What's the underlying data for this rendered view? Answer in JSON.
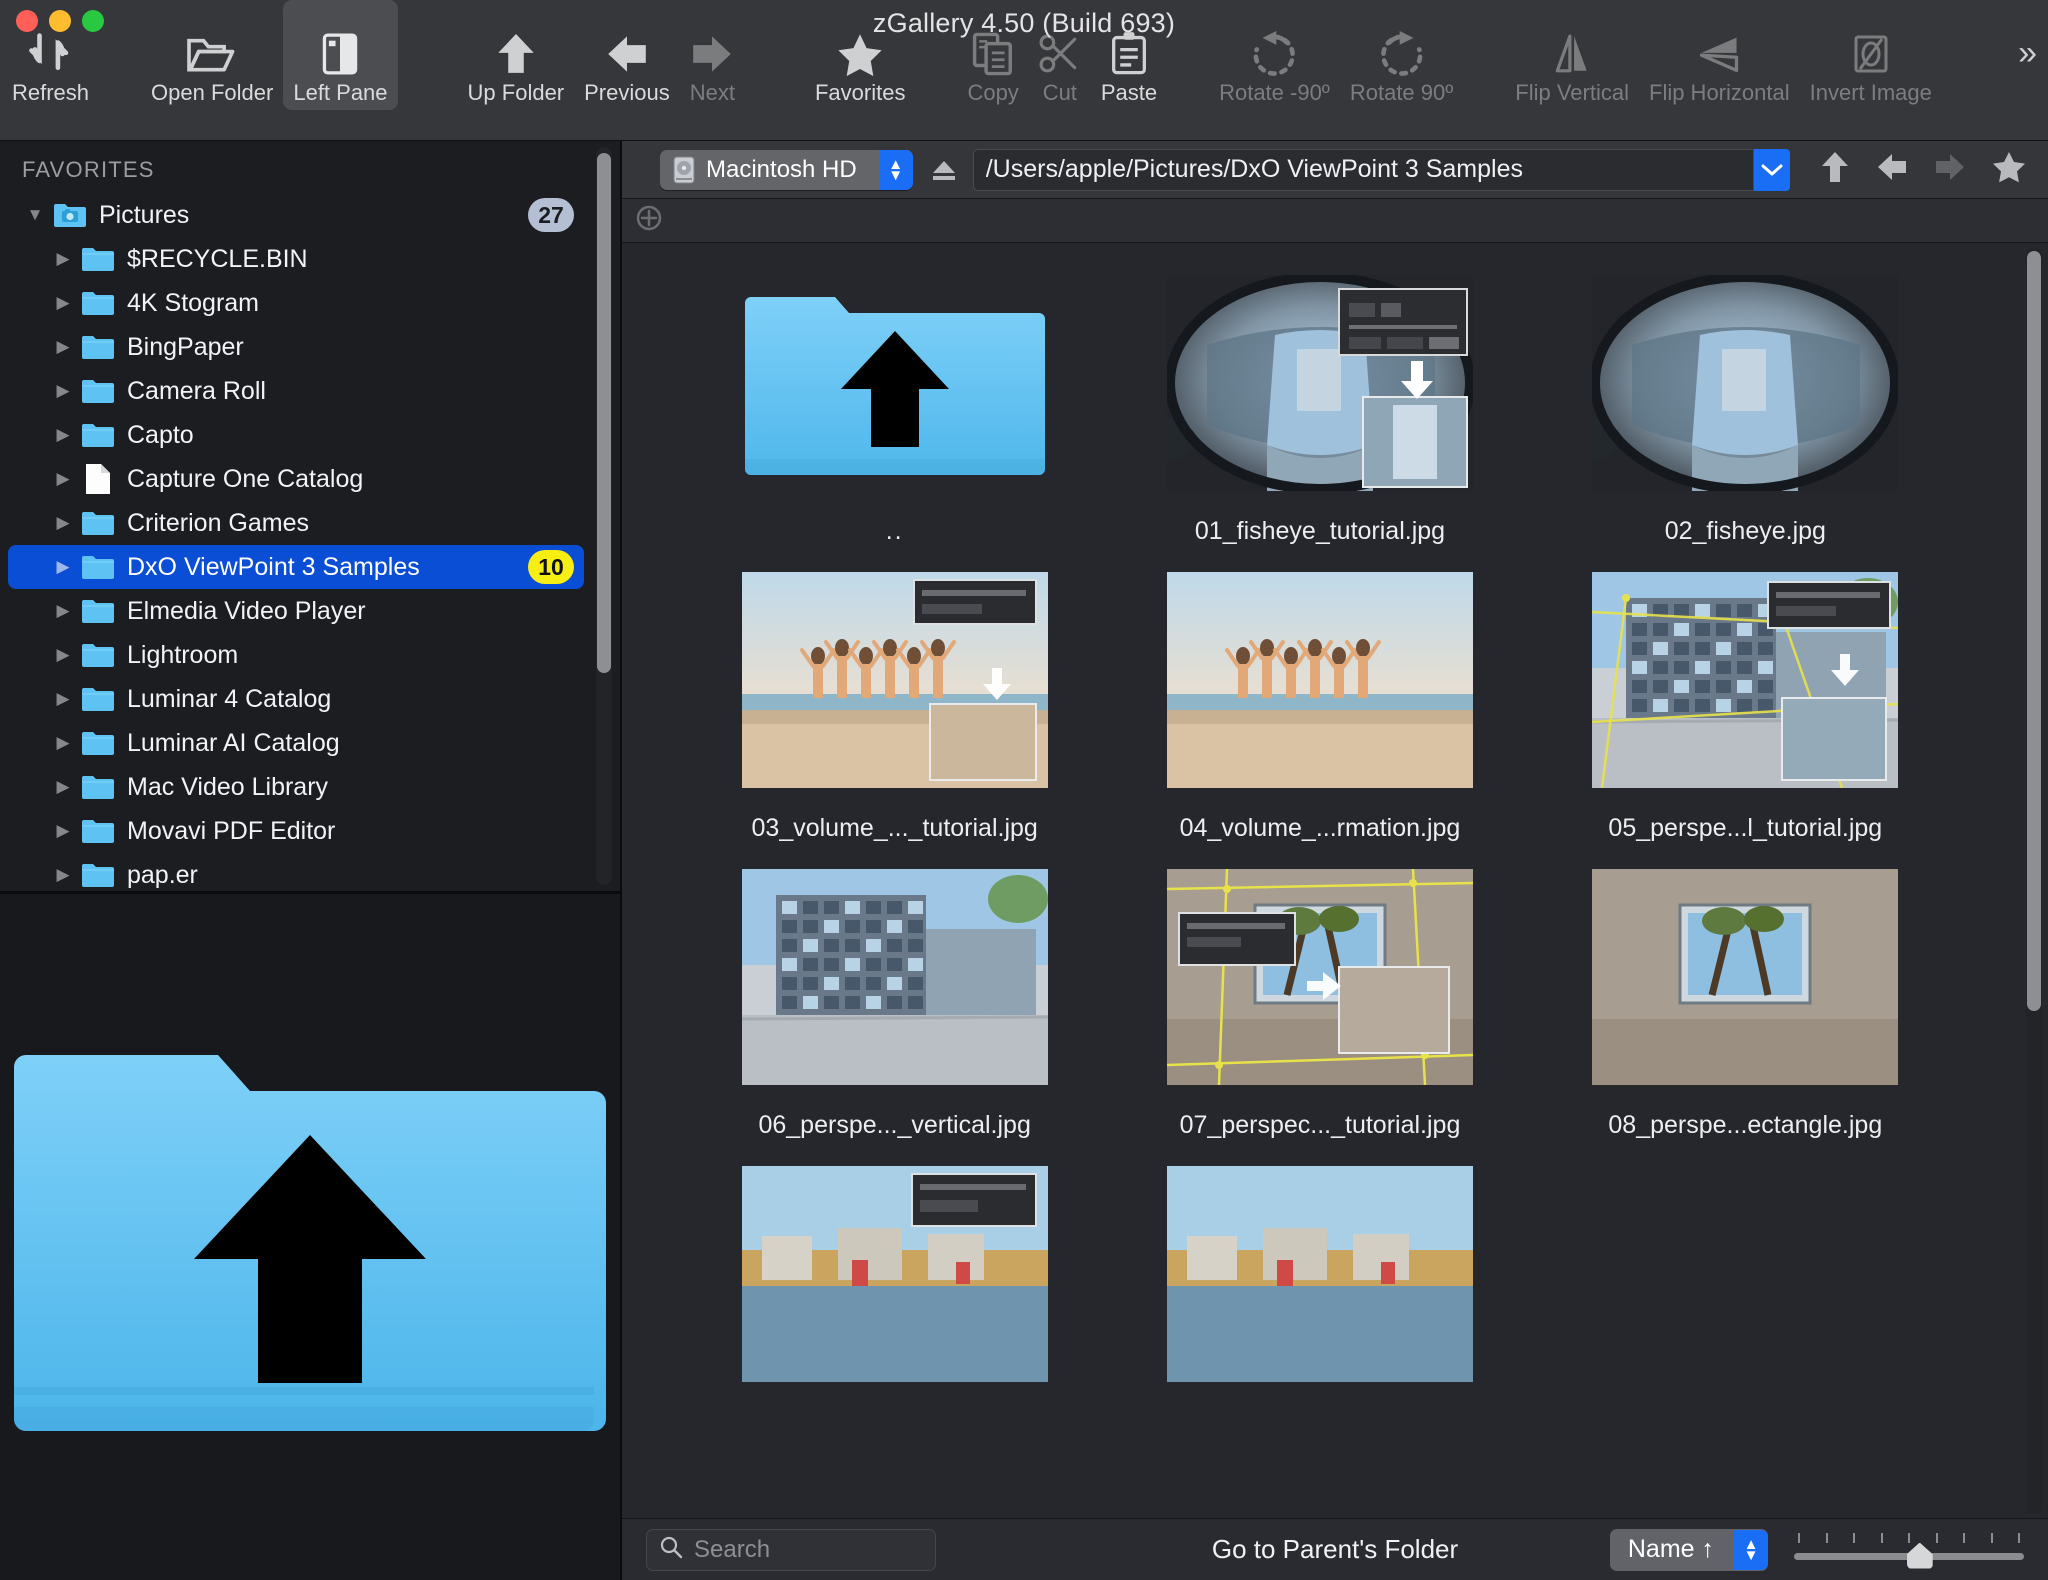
{
  "window": {
    "title": "zGallery 4.50 (Build 693)",
    "traffic": [
      "close",
      "minimize",
      "zoom"
    ]
  },
  "toolbar": {
    "more_glyph": "»",
    "items": [
      {
        "label": "Refresh",
        "icon": "refresh-icon",
        "state": "normal",
        "name": "refresh"
      },
      {
        "label": "Open Folder",
        "icon": "open-folder-icon",
        "state": "normal",
        "name": "open-folder"
      },
      {
        "label": "Left Pane",
        "icon": "left-pane-icon",
        "state": "active",
        "name": "left-pane"
      },
      {
        "label": "Up Folder",
        "icon": "up-arrow-icon",
        "state": "normal",
        "name": "up-folder"
      },
      {
        "label": "Previous",
        "icon": "left-arrow-icon",
        "state": "normal",
        "name": "previous"
      },
      {
        "label": "Next",
        "icon": "right-arrow-icon",
        "state": "dim",
        "name": "next"
      },
      {
        "label": "Favorites",
        "icon": "star-icon",
        "state": "normal",
        "name": "favorites"
      },
      {
        "label": "Copy",
        "icon": "copy-icon",
        "state": "dim",
        "name": "copy"
      },
      {
        "label": "Cut",
        "icon": "scissors-icon",
        "state": "dim",
        "name": "cut"
      },
      {
        "label": "Paste",
        "icon": "clipboard-icon",
        "state": "normal",
        "name": "paste"
      },
      {
        "label": "Rotate -90º",
        "icon": "rotate-ccw-icon",
        "state": "dim",
        "name": "rotate-minus-90"
      },
      {
        "label": "Rotate 90º",
        "icon": "rotate-cw-icon",
        "state": "dim",
        "name": "rotate-90"
      },
      {
        "label": "Flip Vertical",
        "icon": "flip-vertical-icon",
        "state": "dim",
        "name": "flip-vertical"
      },
      {
        "label": "Flip Horizontal",
        "icon": "flip-horizontal-icon",
        "state": "dim",
        "name": "flip-horizontal"
      },
      {
        "label": "Invert Image",
        "icon": "invert-image-icon",
        "state": "dim",
        "name": "invert-image"
      }
    ]
  },
  "sidebar": {
    "section_title": "FAVORITES",
    "items": [
      {
        "label": "Pictures",
        "depth": 1,
        "icon": "camera-folder-icon",
        "twisty": "down",
        "badge": "27",
        "badge_color": "#b4bfd4",
        "selected": false
      },
      {
        "label": "$RECYCLE.BIN",
        "depth": 2,
        "icon": "folder-icon",
        "twisty": "right",
        "badge": null,
        "badge_color": null,
        "selected": false
      },
      {
        "label": "4K Stogram",
        "depth": 2,
        "icon": "folder-icon",
        "twisty": "right",
        "badge": null,
        "badge_color": null,
        "selected": false
      },
      {
        "label": "BingPaper",
        "depth": 2,
        "icon": "folder-icon",
        "twisty": "right",
        "badge": null,
        "badge_color": null,
        "selected": false
      },
      {
        "label": "Camera Roll",
        "depth": 2,
        "icon": "folder-icon",
        "twisty": "right",
        "badge": null,
        "badge_color": null,
        "selected": false
      },
      {
        "label": "Capto",
        "depth": 2,
        "icon": "folder-icon",
        "twisty": "right",
        "badge": null,
        "badge_color": null,
        "selected": false
      },
      {
        "label": "Capture One Catalog",
        "depth": 2,
        "icon": "document-icon",
        "twisty": "right",
        "badge": null,
        "badge_color": null,
        "selected": false
      },
      {
        "label": "Criterion Games",
        "depth": 2,
        "icon": "folder-icon",
        "twisty": "right",
        "badge": null,
        "badge_color": null,
        "selected": false
      },
      {
        "label": "DxO ViewPoint 3 Samples",
        "depth": 2,
        "icon": "folder-icon",
        "twisty": "right",
        "badge": "10",
        "badge_color": "#f7ef13",
        "selected": true
      },
      {
        "label": "Elmedia Video Player",
        "depth": 2,
        "icon": "folder-icon",
        "twisty": "right",
        "badge": null,
        "badge_color": null,
        "selected": false
      },
      {
        "label": "Lightroom",
        "depth": 2,
        "icon": "folder-icon",
        "twisty": "right",
        "badge": null,
        "badge_color": null,
        "selected": false
      },
      {
        "label": "Luminar 4 Catalog",
        "depth": 2,
        "icon": "folder-icon",
        "twisty": "right",
        "badge": null,
        "badge_color": null,
        "selected": false
      },
      {
        "label": "Luminar AI Catalog",
        "depth": 2,
        "icon": "folder-icon",
        "twisty": "right",
        "badge": null,
        "badge_color": null,
        "selected": false
      },
      {
        "label": "Mac Video Library",
        "depth": 2,
        "icon": "folder-icon",
        "twisty": "right",
        "badge": null,
        "badge_color": null,
        "selected": false
      },
      {
        "label": "Movavi PDF Editor",
        "depth": 2,
        "icon": "folder-icon",
        "twisty": "right",
        "badge": null,
        "badge_color": null,
        "selected": false
      },
      {
        "label": "pap.er",
        "depth": 2,
        "icon": "folder-icon",
        "twisty": "right",
        "badge": null,
        "badge_color": null,
        "selected": false
      }
    ]
  },
  "preview": {
    "kind": "parent-folder-icon",
    "alt": "blue folder with black up arrow"
  },
  "pathbar": {
    "drive_label": "Macintosh HD",
    "drive_icon": "hard-disk-icon",
    "eject_icon": "eject-icon",
    "path": "/Users/apple/Pictures/DxO ViewPoint 3 Samples",
    "dropdown_glyph": "⌄",
    "nav": [
      {
        "name": "go-up",
        "icon": "up-arrow-icon",
        "state": "normal"
      },
      {
        "name": "go-back",
        "icon": "left-arrow-icon",
        "state": "normal"
      },
      {
        "name": "go-forward",
        "icon": "right-arrow-icon",
        "state": "dim"
      },
      {
        "name": "add-favorite",
        "icon": "star-icon",
        "state": "normal"
      }
    ]
  },
  "tabstrip": {
    "add_tab_icon": "plus-circle-icon"
  },
  "grid": {
    "items": [
      {
        "caption": "..",
        "kind": "parent-folder"
      },
      {
        "caption": "01_fisheye_tutorial.jpg",
        "kind": "fisheye-tutorial"
      },
      {
        "caption": "02_fisheye.jpg",
        "kind": "fisheye"
      },
      {
        "caption": "03_volume_..._tutorial.jpg",
        "kind": "beach-tutorial"
      },
      {
        "caption": "04_volume_...rmation.jpg",
        "kind": "beach"
      },
      {
        "caption": "05_perspe...l_tutorial.jpg",
        "kind": "building-tutorial"
      },
      {
        "caption": "06_perspe..._vertical.jpg",
        "kind": "building"
      },
      {
        "caption": "07_perspec..._tutorial.jpg",
        "kind": "bench-tutorial"
      },
      {
        "caption": "08_perspe...ectangle.jpg",
        "kind": "bench"
      },
      {
        "caption": "",
        "kind": "river-tutorial"
      },
      {
        "caption": "",
        "kind": "river"
      }
    ]
  },
  "statusbar": {
    "search_placeholder": "Search",
    "search_value": "",
    "search_icon": "search-icon",
    "message": "Go to Parent's Folder",
    "sort_label": "Name ↑",
    "zoom_ticks": 9
  },
  "colors": {
    "accent_blue": "#1a6ef5",
    "selection_blue": "#0a4ed6",
    "badge_yellow": "#f7ef13",
    "folder_blue": "#5ec2f2",
    "toolbar_bg": "#36373a",
    "window_bg": "#26272c"
  }
}
